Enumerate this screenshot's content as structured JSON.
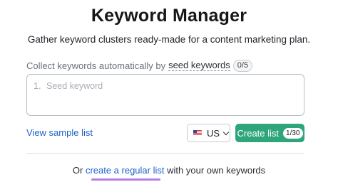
{
  "header": {
    "title": "Keyword Manager",
    "subtitle": "Gather keyword clusters ready-made for a content marketing plan."
  },
  "collect": {
    "prefix": "Collect keywords automatically by",
    "seed_link": "seed keywords",
    "counter": "0/5"
  },
  "input": {
    "line_number": "1.",
    "placeholder": "Seed keyword"
  },
  "actions": {
    "sample_link": "View sample list",
    "country": "US",
    "country_flag_icon": "us-flag-icon",
    "create_label": "Create list",
    "create_badge": "1/30"
  },
  "footer": {
    "prefix": "Or",
    "regular_link": "create a regular list",
    "suffix": "with your own keywords"
  },
  "colors": {
    "primary_green": "#2fa57b",
    "link_blue": "#1d62c9",
    "accent_purple": "#b57de0"
  }
}
